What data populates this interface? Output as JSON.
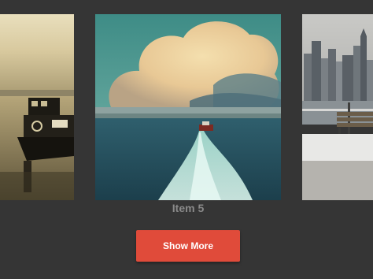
{
  "carousel": {
    "active_caption": "Item 5",
    "slides": [
      {
        "position": "left",
        "subject": "tugboat-at-dusk"
      },
      {
        "position": "center",
        "subject": "boat-wake-under-clouds"
      },
      {
        "position": "right",
        "subject": "city-skyline-with-bench"
      }
    ]
  },
  "actions": {
    "show_more_label": "Show More"
  },
  "colors": {
    "background": "#353535",
    "button": "#e04b3a",
    "caption": "#8a8a8a"
  }
}
